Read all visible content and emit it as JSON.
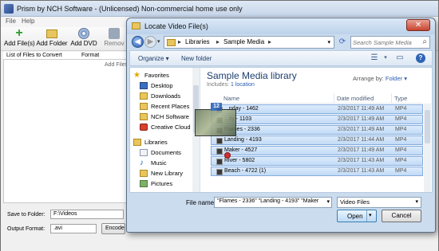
{
  "app": {
    "title": "Prism by NCH Software - (Unlicensed) Non-commercial home use only",
    "menu": [
      "File",
      "Help"
    ],
    "toolbar": {
      "add_files": "Add File(s)",
      "add_folder": "Add Folder",
      "add_dvd": "Add DVD",
      "remove": "Remov"
    },
    "list_headers": [
      "List of Files to Convert",
      "Format"
    ],
    "list_hint": "Add Files",
    "save_to_label": "Save to Folder:",
    "save_to_value": "F:\\Videos",
    "output_label": "Output Format:",
    "output_value": ".avi",
    "encoder_label": "Encode"
  },
  "dialog": {
    "title": "Locate Video File(s)",
    "close_label": "✕",
    "breadcrumb": [
      "Libraries",
      "Sample Media"
    ],
    "search_placeholder": "Search Sample Media",
    "commands": {
      "organize": "Organize ▾",
      "new_folder": "New folder"
    },
    "nav": {
      "favorites": "Favorites",
      "desktop": "Desktop",
      "downloads": "Downloads",
      "recent": "Recent Places",
      "nch": "NCH Software",
      "cloud": "Creative Cloud",
      "libraries": "Libraries",
      "documents": "Documents",
      "music": "Music",
      "new_library": "New Library",
      "pictures": "Pictures"
    },
    "library_title": "Sample Media library",
    "library_includes": "Includes:",
    "library_location": "1 location",
    "arrange_label": "Arrange by:",
    "arrange_value": "Folder ▾",
    "columns": [
      "Name",
      "Date modified",
      "Type"
    ],
    "files": [
      {
        "name": "...nday - 1462",
        "date": "2/3/2017 11:49 AM",
        "type": "MP4"
      },
      {
        "name": "...ity - 1103",
        "date": "2/3/2017 11:49 AM",
        "type": "MP4"
      },
      {
        "name": "Flames - 2336",
        "date": "2/3/2017 11:49 AM",
        "type": "MP4"
      },
      {
        "name": "Landing - 4193",
        "date": "2/3/2017 11:44 AM",
        "type": "MP4"
      },
      {
        "name": "Maker - 4527",
        "date": "2/3/2017 11:49 AM",
        "type": "MP4"
      },
      {
        "name": "River - 5802",
        "date": "2/3/2017 11:43 AM",
        "type": "MP4"
      },
      {
        "name": "Beach - 4722 (1)",
        "date": "2/3/2017 11:43 AM",
        "type": "MP4"
      }
    ],
    "drag_count": "12",
    "filename_label": "File name:",
    "filename_value": "\"Flames - 2336\" \"Landing - 4193\" \"Maker",
    "filetype_value": "Video Files",
    "open_label": "Open",
    "cancel_label": "Cancel"
  }
}
